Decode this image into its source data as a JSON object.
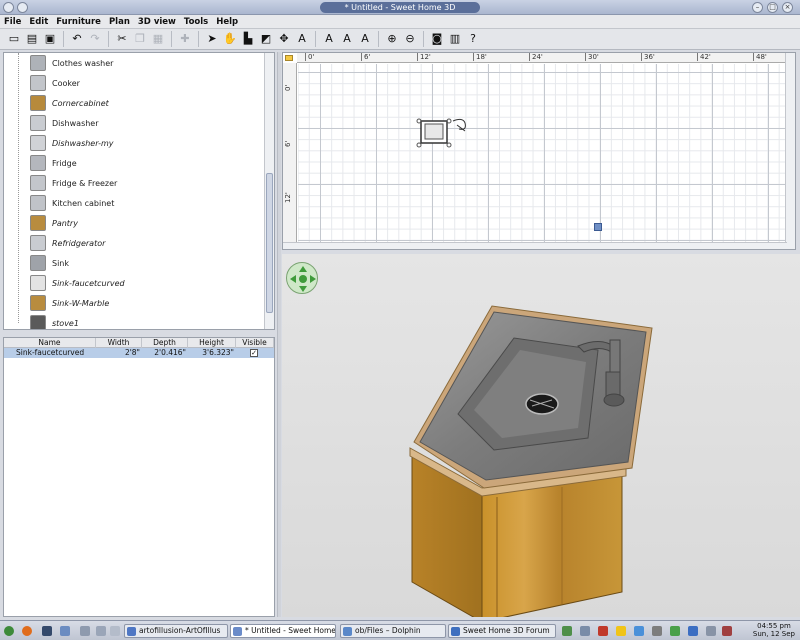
{
  "window": {
    "title": "* Untitled - Sweet Home 3D"
  },
  "menu": [
    "File",
    "Edit",
    "Furniture",
    "Plan",
    "3D view",
    "Tools",
    "Help"
  ],
  "toolbar": [
    {
      "name": "new-icon",
      "glyph": "▭"
    },
    {
      "name": "open-icon",
      "glyph": "▤"
    },
    {
      "name": "save-icon",
      "glyph": "▣"
    },
    {
      "name": "undo-icon",
      "glyph": "↶"
    },
    {
      "name": "redo-icon",
      "glyph": "↷",
      "disabled": true
    },
    {
      "name": "cut-icon",
      "glyph": "✂"
    },
    {
      "name": "copy-icon",
      "glyph": "❐",
      "disabled": true
    },
    {
      "name": "paste-icon",
      "glyph": "▦",
      "disabled": true
    },
    {
      "name": "add-furniture-icon",
      "glyph": "✚",
      "disabled": true
    },
    {
      "name": "select-icon",
      "glyph": "➤"
    },
    {
      "name": "pan-icon",
      "glyph": "✋"
    },
    {
      "name": "create-walls-icon",
      "glyph": "▙"
    },
    {
      "name": "create-rooms-icon",
      "glyph": "◩"
    },
    {
      "name": "create-dimensions-icon",
      "glyph": "✥"
    },
    {
      "name": "add-text-icon",
      "glyph": "A"
    },
    {
      "name": "text-style-icon",
      "glyph": "A"
    },
    {
      "name": "text-bold-icon",
      "glyph": "A"
    },
    {
      "name": "text-italic-icon",
      "glyph": "A"
    },
    {
      "name": "zoom-in-icon",
      "glyph": "⊕"
    },
    {
      "name": "zoom-out-icon",
      "glyph": "⊖"
    },
    {
      "name": "create-photo-icon",
      "glyph": "◙"
    },
    {
      "name": "import-icon",
      "glyph": "▥"
    },
    {
      "name": "help-icon",
      "glyph": "?"
    }
  ],
  "catalog": [
    {
      "label": "Clothes washer",
      "italic": false,
      "color": "#aeb2b8"
    },
    {
      "label": "Cooker",
      "italic": false,
      "color": "#c2c5ca"
    },
    {
      "label": "Cornercabinet",
      "italic": true,
      "color": "#b78a3c"
    },
    {
      "label": "Dishwasher",
      "italic": false,
      "color": "#c9ccd1"
    },
    {
      "label": "Dishwasher-my",
      "italic": true,
      "color": "#d0d2d6"
    },
    {
      "label": "Fridge",
      "italic": false,
      "color": "#b4b7bd"
    },
    {
      "label": "Fridge & Freezer",
      "italic": false,
      "color": "#c3c6cb"
    },
    {
      "label": "Kitchen cabinet",
      "italic": false,
      "color": "#c0c3c8"
    },
    {
      "label": "Pantry",
      "italic": true,
      "color": "#b88c3f"
    },
    {
      "label": "Refridgerator",
      "italic": true,
      "color": "#c9ccd1"
    },
    {
      "label": "Sink",
      "italic": false,
      "color": "#9fa3a9"
    },
    {
      "label": "Sink-faucetcurved",
      "italic": true,
      "color": "#e3e3e3"
    },
    {
      "label": "Sink-W-Marble",
      "italic": true,
      "color": "#b88c3f"
    },
    {
      "label": "stove1",
      "italic": true,
      "color": "#5a5a5a"
    }
  ],
  "furniture_table": {
    "headers": [
      "Name",
      "Width",
      "Depth",
      "Height",
      "Visible"
    ],
    "rows": [
      {
        "name": "Sink-faucetcurved",
        "width": "2'8\"",
        "depth": "2'0.416\"",
        "height": "3'6.323\"",
        "visible": true
      }
    ]
  },
  "plan": {
    "ruler_x": [
      "0'",
      "6'",
      "12'",
      "18'",
      "24'",
      "30'",
      "36'",
      "42'",
      "48'"
    ],
    "ruler_y": [
      "0'",
      "6'",
      "12'"
    ]
  },
  "taskbar": {
    "tasks": [
      {
        "label": "artofillusion-ArtOfIllus",
        "color": "#4f77c4"
      },
      {
        "label": "* Untitled - Sweet Home",
        "color": "#6a8bc9"
      },
      {
        "label": "ob/Files – Dolphin",
        "color": "#5a88c9"
      },
      {
        "label": "Sweet Home 3D Forum",
        "color": "#3e6fbf"
      }
    ],
    "clock_time": "04:55 pm",
    "clock_date": "Sun, 12 Sep"
  }
}
